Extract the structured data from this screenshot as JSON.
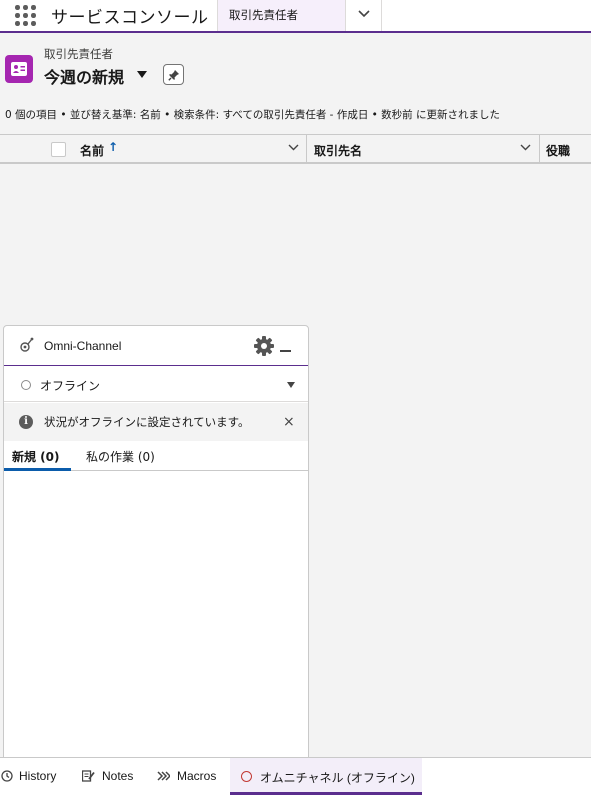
{
  "app": {
    "name": "サービスコンソール",
    "tabs": [
      {
        "label": "取引先責任者",
        "active": true
      }
    ]
  },
  "list": {
    "object_label": "取引先責任者",
    "view_name": "今週の新規",
    "meta": "0 個の項目 • 並び替え基準: 名前 • 検索条件: すべての取引先責任者 - 作成日 • 数秒前 に更新されました",
    "columns": [
      {
        "label": "名前",
        "sorted": "asc"
      },
      {
        "label": "取引先名"
      },
      {
        "label": "役職"
      }
    ],
    "rows": []
  },
  "omni": {
    "title": "Omni-Channel",
    "status": "オフライン",
    "notice": "状況がオフラインに設定されています。",
    "notice_icon": "i",
    "close_glyph": "×",
    "tabs": [
      {
        "label": "新規 (0)",
        "active": true
      },
      {
        "label": "私の作業 (0)"
      }
    ]
  },
  "utility_bar": {
    "items": [
      {
        "label": "History",
        "icon": "clock-icon"
      },
      {
        "label": "Notes",
        "icon": "notes-icon"
      },
      {
        "label": "Macros",
        "icon": "macros-icon"
      },
      {
        "label": "オムニチャネル (オフライン)",
        "icon": "status-ring-icon",
        "active": true
      }
    ]
  },
  "colors": {
    "brand": "#5b2e8e",
    "object_icon": "#a526b0",
    "sort_arrow": "#0b5cab",
    "offline_ring": "#c23934"
  }
}
